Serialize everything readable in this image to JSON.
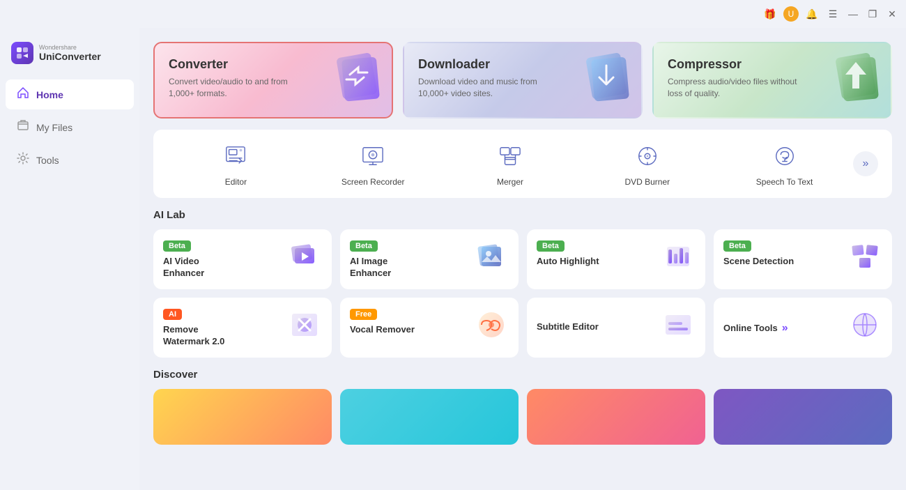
{
  "titlebar": {
    "icons": {
      "gift": "🎁",
      "user": "U",
      "bell": "🔔",
      "menu": "☰"
    },
    "window_controls": {
      "minimize": "—",
      "maximize": "❐",
      "close": "✕"
    }
  },
  "logo": {
    "brand": "Wondershare",
    "name": "UniConverter",
    "icon": "▶"
  },
  "sidebar": {
    "items": [
      {
        "id": "home",
        "label": "Home",
        "icon": "🏠",
        "active": true
      },
      {
        "id": "myfiles",
        "label": "My Files",
        "icon": "📁",
        "active": false
      },
      {
        "id": "tools",
        "label": "Tools",
        "icon": "🔧",
        "active": false
      }
    ]
  },
  "top_cards": [
    {
      "id": "converter",
      "title": "Converter",
      "desc": "Convert video/audio to and from 1,000+ formats.",
      "style": "converter"
    },
    {
      "id": "downloader",
      "title": "Downloader",
      "desc": "Download video and music from 10,000+ video sites.",
      "style": "downloader"
    },
    {
      "id": "compressor",
      "title": "Compressor",
      "desc": "Compress audio/video files without loss of quality.",
      "style": "compressor"
    }
  ],
  "tools": [
    {
      "id": "editor",
      "label": "Editor"
    },
    {
      "id": "screen-recorder",
      "label": "Screen Recorder"
    },
    {
      "id": "merger",
      "label": "Merger"
    },
    {
      "id": "dvd-burner",
      "label": "DVD Burner"
    },
    {
      "id": "speech-to-text",
      "label": "Speech To Text"
    }
  ],
  "tools_more": "»",
  "ai_lab": {
    "title": "AI Lab",
    "items": [
      {
        "id": "ai-video-enhancer",
        "badge": "Beta",
        "badge_type": "beta",
        "title": "AI Video\nEnhancer"
      },
      {
        "id": "ai-image-enhancer",
        "badge": "Beta",
        "badge_type": "beta",
        "title": "AI Image\nEnhancer"
      },
      {
        "id": "auto-highlight",
        "badge": "Beta",
        "badge_type": "beta",
        "title": "Auto Highlight"
      },
      {
        "id": "scene-detection",
        "badge": "Beta",
        "badge_type": "beta",
        "title": "Scene Detection"
      },
      {
        "id": "remove-watermark",
        "badge": "AI",
        "badge_type": "ai",
        "title": "Remove\nWatermark 2.0"
      },
      {
        "id": "vocal-remover",
        "badge": "Free",
        "badge_type": "free",
        "title": "Vocal Remover"
      },
      {
        "id": "subtitle-editor",
        "badge": "",
        "badge_type": "",
        "title": "Subtitle Editor"
      },
      {
        "id": "online-tools",
        "badge": "",
        "badge_type": "",
        "title": "Online Tools",
        "has_more": true
      }
    ]
  },
  "discover": {
    "title": "Discover",
    "items": [
      {
        "id": "d1",
        "style": "card1"
      },
      {
        "id": "d2",
        "style": "card2"
      },
      {
        "id": "d3",
        "style": "card3"
      },
      {
        "id": "d4",
        "style": "card4"
      }
    ]
  }
}
